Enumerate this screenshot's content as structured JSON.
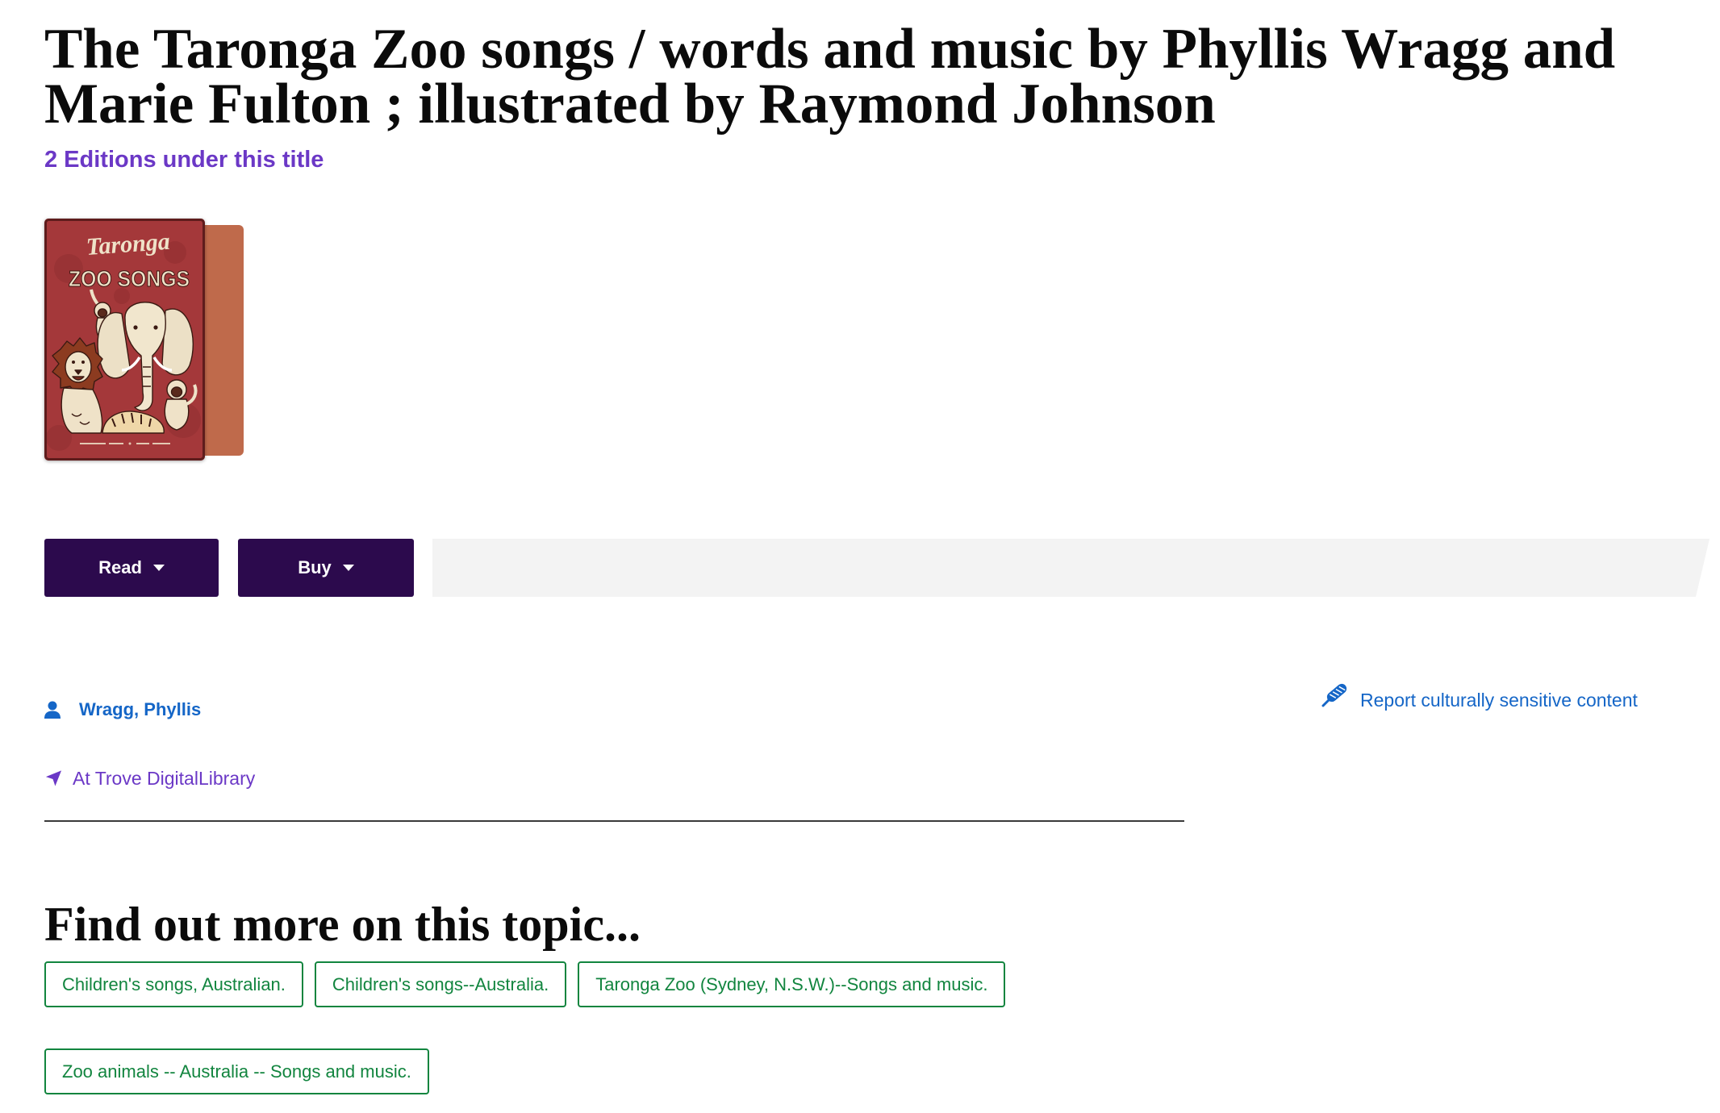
{
  "page": {
    "title": "The Taronga Zoo songs / words and music by Phyllis Wragg and Marie Fulton ; illustrated by Raymond Johnson",
    "editions_link": "2 Editions under this title"
  },
  "cover": {
    "script_title": "Taronga",
    "main_title": "ZOO SONGS",
    "image": "book-cover-illustration"
  },
  "actions": {
    "read_label": "Read",
    "buy_label": "Buy",
    "dropdown_icon": "caret-down-icon"
  },
  "details": {
    "author": "Wragg, Phyllis",
    "author_icon": "person-icon",
    "location": "At Trove DigitalLibrary",
    "location_icon": "location-arrow-icon",
    "report_link": "Report culturally sensitive content",
    "report_icon": "feather-icon"
  },
  "topics": {
    "heading": "Find out more on this topic...",
    "tags": [
      "Children's songs, Australian.",
      "Children's songs--Australia.",
      "Taronga Zoo (Sydney, N.S.W.)--Songs and music.",
      "Zoo animals -- Australia -- Songs and music."
    ]
  },
  "colors": {
    "accent_purple": "#6b38c6",
    "button_bg": "#2c0a4d",
    "link_blue": "#1566c7",
    "tag_green": "#12853f",
    "cover_red": "#a4383a"
  }
}
